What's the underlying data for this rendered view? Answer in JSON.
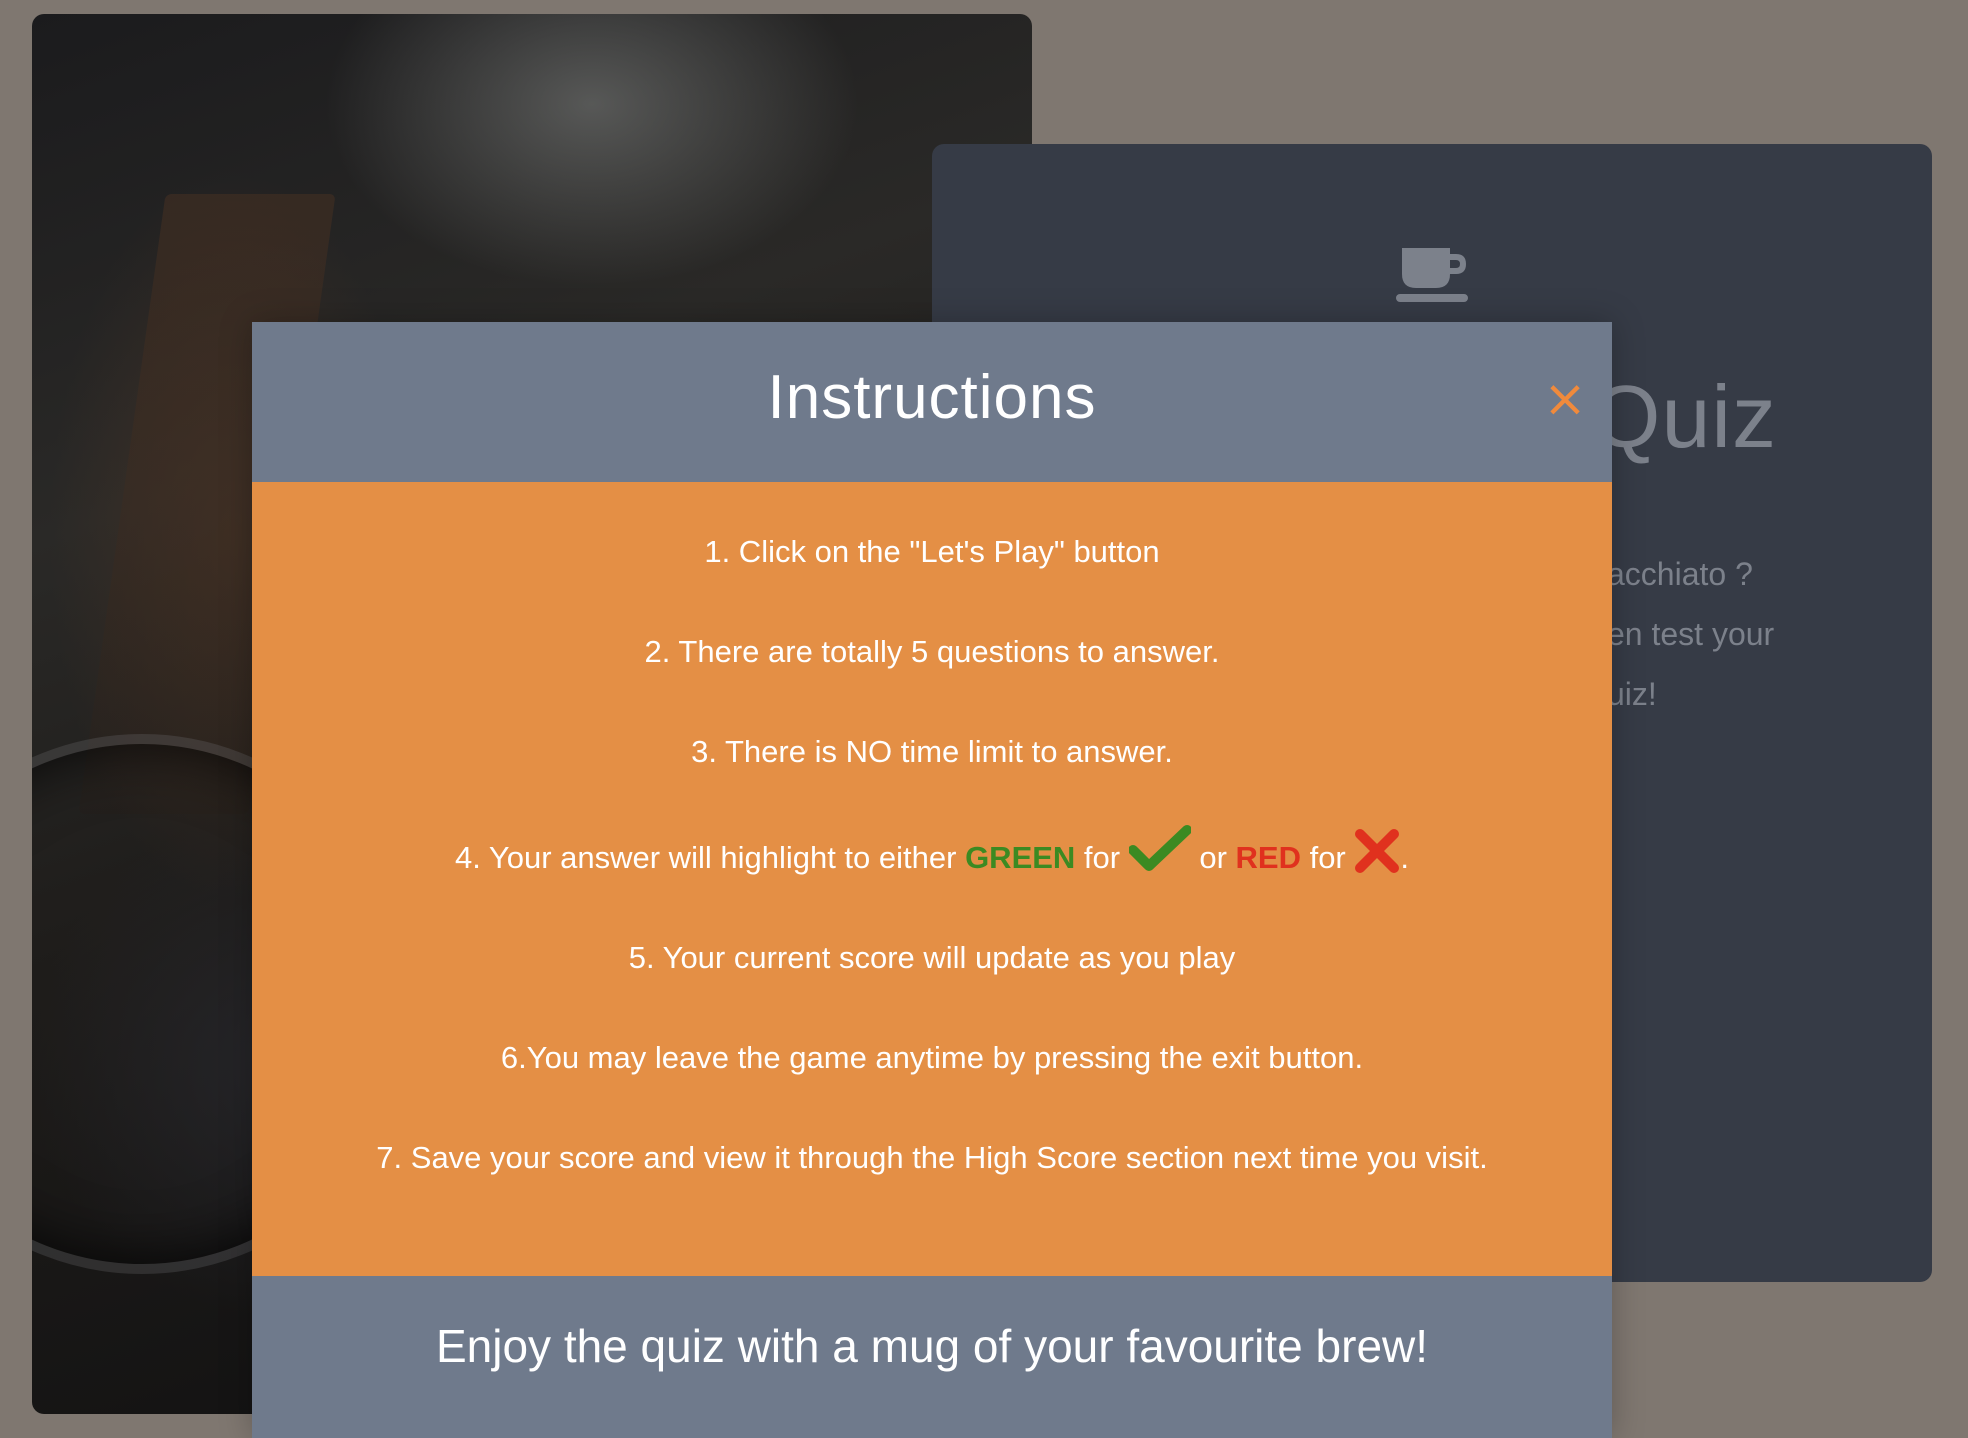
{
  "background": {
    "page_color": "#7f7770"
  },
  "quiz_card": {
    "title_partial": "Quiz",
    "intro_lines": [
      "acchiato ?",
      "en test your",
      "uiz!"
    ],
    "icon": "mug-icon"
  },
  "modal": {
    "title": "Instructions",
    "close_label": "×",
    "instructions": {
      "item1": "1. Click on the \"Let's Play\" button",
      "item2": "2. There are totally 5 questions to answer.",
      "item3": "3. There is NO time limit to answer.",
      "item4": {
        "prefix": "4. Your answer will highlight to either ",
        "green_word": "GREEN",
        "for1": " for ",
        "or_text": " or ",
        "red_word": "RED",
        "for2": " for ",
        "suffix": "."
      },
      "item5": "5. Your current score will update as you play",
      "item6": "6.You may leave the game anytime by pressing the exit button.",
      "item7": "7. Save your score and view it through the High Score section next time you visit."
    },
    "footer": "Enjoy the quiz with a mug of your favourite brew!",
    "colors": {
      "header_footer": "#6f7a8c",
      "body": "#e48f45",
      "close": "#f08a3c",
      "green": "#3c8a22",
      "red": "#e0311e"
    },
    "icons": {
      "check": "checkmark-icon",
      "cross": "cross-icon"
    }
  }
}
